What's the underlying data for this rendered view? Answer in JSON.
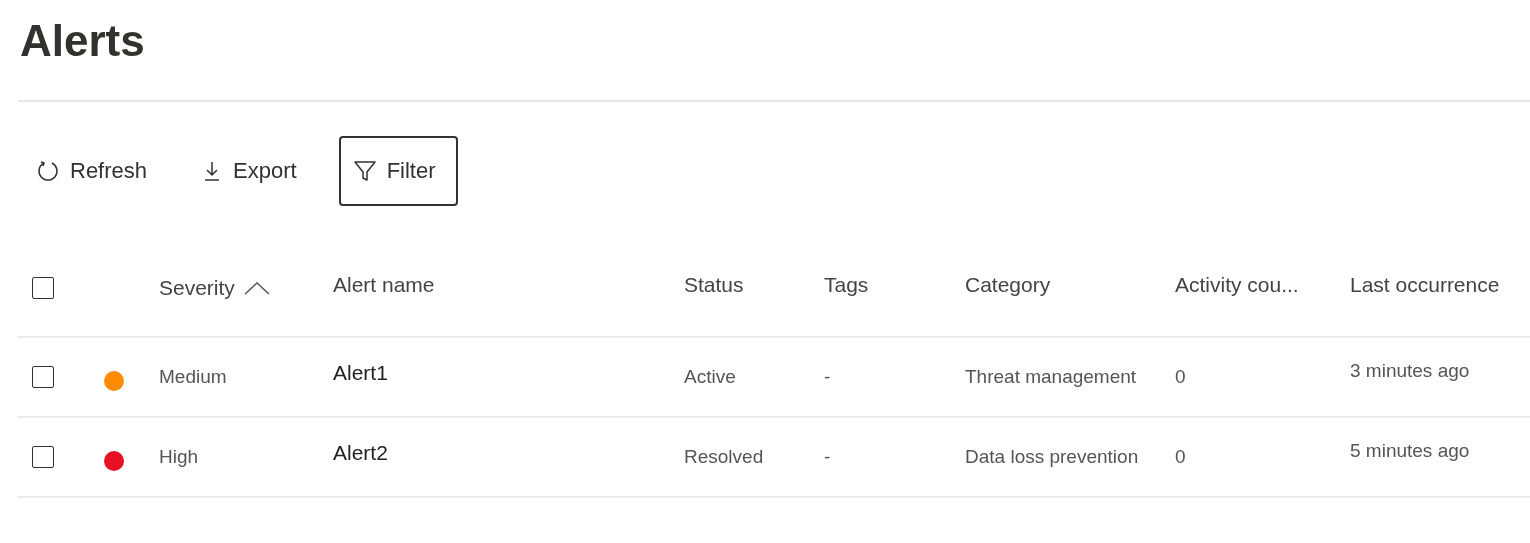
{
  "page": {
    "title": "Alerts"
  },
  "toolbar": [
    {
      "kind": "refresh",
      "label": "Refresh",
      "focused": false
    },
    {
      "kind": "export",
      "label": "Export",
      "focused": false
    },
    {
      "kind": "filter",
      "label": "Filter",
      "focused": true
    }
  ],
  "table": {
    "select_all": {
      "checked": false
    },
    "columns": [
      {
        "label": "Severity",
        "sorted": true
      },
      {
        "label": "Alert name",
        "sorted": false
      },
      {
        "label": "Status",
        "sorted": false
      },
      {
        "label": "Tags",
        "sorted": false
      },
      {
        "label": "Category",
        "sorted": false
      },
      {
        "label": "Activity cou...",
        "sorted": false
      },
      {
        "label": "Last occurrence",
        "sorted": false
      }
    ],
    "rows": [
      {
        "checked": false,
        "color": "#ff8c00",
        "severity": "Medium",
        "name": "Alert1",
        "status": "Active",
        "tags": "-",
        "category": "Threat management",
        "activity": "0",
        "last": "3 minutes ago"
      },
      {
        "checked": false,
        "color": "#e81123",
        "severity": "High",
        "name": "Alert2",
        "status": "Resolved",
        "tags": "-",
        "category": "Data loss prevention",
        "activity": "0",
        "last": "5 minutes ago"
      }
    ]
  }
}
